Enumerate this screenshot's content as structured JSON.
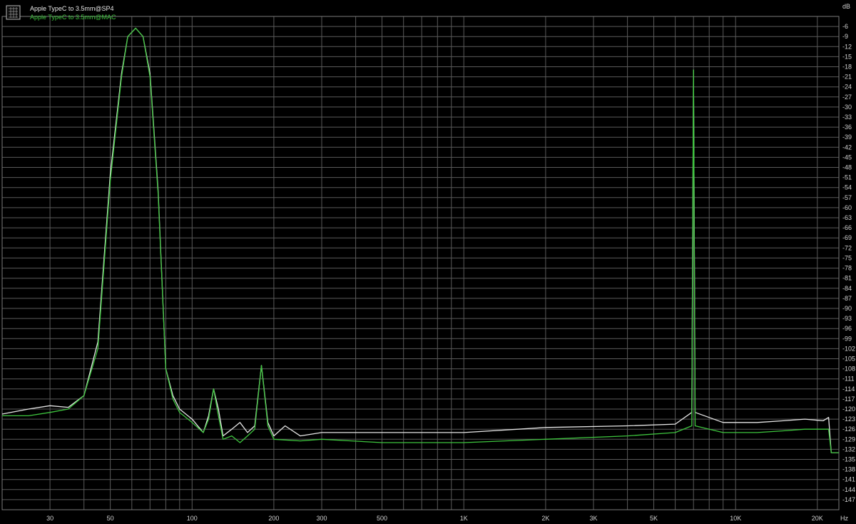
{
  "chart_data": {
    "type": "line",
    "x_scale": "log",
    "y_scale": "linear",
    "xlim": [
      20,
      24000
    ],
    "ylim": [
      -150,
      -3
    ],
    "grid": true,
    "legend_position": "top-left",
    "background": "#000000",
    "grid_color": "#5a5a5a",
    "y_unit": "dB",
    "x_unit": "Hz",
    "x_ticks": [
      {
        "value": 30,
        "label": "30"
      },
      {
        "value": 50,
        "label": "50"
      },
      {
        "value": 100,
        "label": "100"
      },
      {
        "value": 200,
        "label": "200"
      },
      {
        "value": 300,
        "label": "300"
      },
      {
        "value": 500,
        "label": "500"
      },
      {
        "value": 1000,
        "label": "1K"
      },
      {
        "value": 2000,
        "label": "2K"
      },
      {
        "value": 3000,
        "label": "3K"
      },
      {
        "value": 5000,
        "label": "5K"
      },
      {
        "value": 10000,
        "label": "10K"
      },
      {
        "value": 20000,
        "label": "20K"
      }
    ],
    "y_ticks": [
      "-6",
      "-9",
      "-12",
      "-15",
      "-18",
      "-21",
      "-24",
      "-27",
      "-30",
      "-33",
      "-36",
      "-39",
      "-42",
      "-45",
      "-48",
      "-51",
      "-54",
      "-57",
      "-60",
      "-63",
      "-66",
      "-69",
      "-72",
      "-75",
      "-78",
      "-81",
      "-84",
      "-87",
      "-90",
      "-93",
      "-96",
      "-99",
      "-102",
      "-105",
      "-108",
      "-111",
      "-114",
      "-117",
      "-120",
      "-123",
      "-126",
      "-129",
      "-132",
      "-135",
      "-138",
      "-141",
      "-144",
      "-147"
    ],
    "series": [
      {
        "name": "Apple TypeC to 3.5mm@SP4",
        "color": "#e6e6e6",
        "points": [
          [
            20,
            -121.5
          ],
          [
            25,
            -120
          ],
          [
            30,
            -119
          ],
          [
            35,
            -119.5
          ],
          [
            40,
            -116
          ],
          [
            45,
            -100
          ],
          [
            50,
            -50
          ],
          [
            55,
            -20
          ],
          [
            58,
            -9
          ],
          [
            62,
            -6.5
          ],
          [
            66,
            -9
          ],
          [
            70,
            -20
          ],
          [
            75,
            -55
          ],
          [
            80,
            -108
          ],
          [
            85,
            -116
          ],
          [
            90,
            -120
          ],
          [
            100,
            -123
          ],
          [
            110,
            -127
          ],
          [
            115,
            -122
          ],
          [
            120,
            -114
          ],
          [
            125,
            -120
          ],
          [
            130,
            -128
          ],
          [
            140,
            -126
          ],
          [
            150,
            -124
          ],
          [
            160,
            -127
          ],
          [
            170,
            -125
          ],
          [
            180,
            -107
          ],
          [
            190,
            -124
          ],
          [
            200,
            -128
          ],
          [
            220,
            -125
          ],
          [
            250,
            -128
          ],
          [
            300,
            -127
          ],
          [
            400,
            -127
          ],
          [
            600,
            -127
          ],
          [
            1000,
            -127
          ],
          [
            2000,
            -125.5
          ],
          [
            4000,
            -125
          ],
          [
            6000,
            -124.5
          ],
          [
            6900,
            -121
          ],
          [
            7000,
            -19
          ],
          [
            7100,
            -121
          ],
          [
            9000,
            -124
          ],
          [
            12000,
            -124
          ],
          [
            15000,
            -123.5
          ],
          [
            18000,
            -123
          ],
          [
            21000,
            -123.5
          ],
          [
            22000,
            -122.5
          ],
          [
            22500,
            -133
          ],
          [
            24000,
            -133
          ]
        ]
      },
      {
        "name": "Apple TypeC to 3.5mm@MAC",
        "color": "#3ec43e",
        "points": [
          [
            20,
            -122
          ],
          [
            25,
            -122
          ],
          [
            30,
            -121
          ],
          [
            35,
            -120
          ],
          [
            40,
            -116
          ],
          [
            45,
            -102
          ],
          [
            50,
            -52
          ],
          [
            55,
            -21
          ],
          [
            58,
            -9
          ],
          [
            62,
            -6.5
          ],
          [
            66,
            -9
          ],
          [
            70,
            -21
          ],
          [
            75,
            -56
          ],
          [
            80,
            -108
          ],
          [
            85,
            -117
          ],
          [
            90,
            -121
          ],
          [
            100,
            -124
          ],
          [
            110,
            -127
          ],
          [
            115,
            -123
          ],
          [
            120,
            -114
          ],
          [
            125,
            -122
          ],
          [
            130,
            -129
          ],
          [
            140,
            -128
          ],
          [
            150,
            -130
          ],
          [
            160,
            -128
          ],
          [
            170,
            -126
          ],
          [
            180,
            -107
          ],
          [
            190,
            -125
          ],
          [
            200,
            -129
          ],
          [
            250,
            -129.5
          ],
          [
            300,
            -129
          ],
          [
            500,
            -130
          ],
          [
            1000,
            -130
          ],
          [
            2000,
            -129
          ],
          [
            4000,
            -128
          ],
          [
            6000,
            -127
          ],
          [
            6900,
            -125
          ],
          [
            7000,
            -19
          ],
          [
            7100,
            -125
          ],
          [
            9000,
            -127
          ],
          [
            12000,
            -127
          ],
          [
            15000,
            -126.5
          ],
          [
            18000,
            -126
          ],
          [
            22000,
            -126
          ],
          [
            22500,
            -133
          ],
          [
            24000,
            -133
          ]
        ]
      }
    ]
  }
}
